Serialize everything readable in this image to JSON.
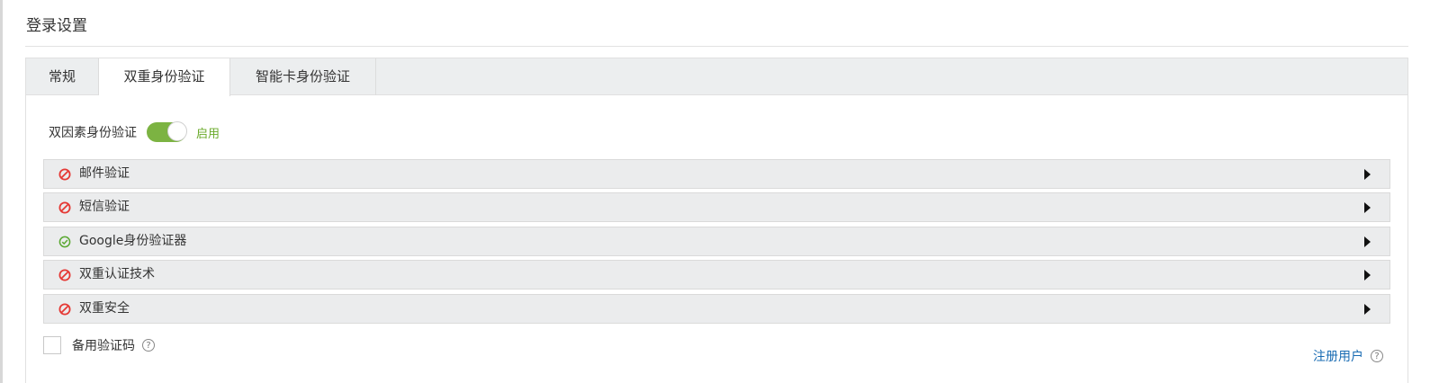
{
  "page": {
    "title": "登录设置"
  },
  "tabs": [
    {
      "label": "常规",
      "active": false
    },
    {
      "label": "双重身份验证",
      "active": true
    },
    {
      "label": "智能卡身份验证",
      "active": false
    }
  ],
  "tfa": {
    "label": "双因素身份验证",
    "enabled": true,
    "state_text": "启用"
  },
  "methods": [
    {
      "label": "邮件验证",
      "status": "disabled",
      "icon": "blocked-icon"
    },
    {
      "label": "短信验证",
      "status": "disabled",
      "icon": "blocked-icon"
    },
    {
      "label": "Google身份验证器",
      "status": "enabled",
      "icon": "check-circle-icon"
    },
    {
      "label": "双重认证技术",
      "status": "disabled",
      "icon": "blocked-icon"
    },
    {
      "label": "双重安全",
      "status": "disabled",
      "icon": "blocked-icon"
    }
  ],
  "backup": {
    "label": "备用验证码",
    "checked": false
  },
  "registered_users": {
    "label": "注册用户"
  },
  "help_glyph": "?",
  "colors": {
    "accent_green": "#7cb342",
    "enabled_text": "#6aaa2a",
    "blocked_red": "#e53935",
    "check_green": "#5aa832",
    "link_blue": "#1a6cb3"
  }
}
